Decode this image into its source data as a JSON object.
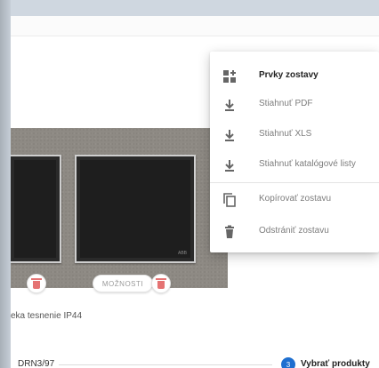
{
  "menu": {
    "items": [
      {
        "label": "Prvky zostavy",
        "icon": "grid-add-icon"
      },
      {
        "label": "Stiahnuť PDF",
        "icon": "download-icon"
      },
      {
        "label": "Stiahnuť XLS",
        "icon": "download-icon"
      },
      {
        "label": "Stiahnuť katalógové listy",
        "icon": "download-icon"
      },
      {
        "label": "Kopírovať zostavu",
        "icon": "copy-icon"
      },
      {
        "label": "Odstrániť zostavu",
        "icon": "trash-icon"
      }
    ]
  },
  "product": {
    "options_label": "MOŽNOSTI",
    "description": "eka tesnenie IP44",
    "code": "DRN3/97",
    "brand_mark": "ABB"
  },
  "step": {
    "number": "3",
    "label": "Vybrať produkty"
  },
  "colors": {
    "accent": "#1e6fd0",
    "delete": "#e57373",
    "frame": "#8e8a84"
  }
}
